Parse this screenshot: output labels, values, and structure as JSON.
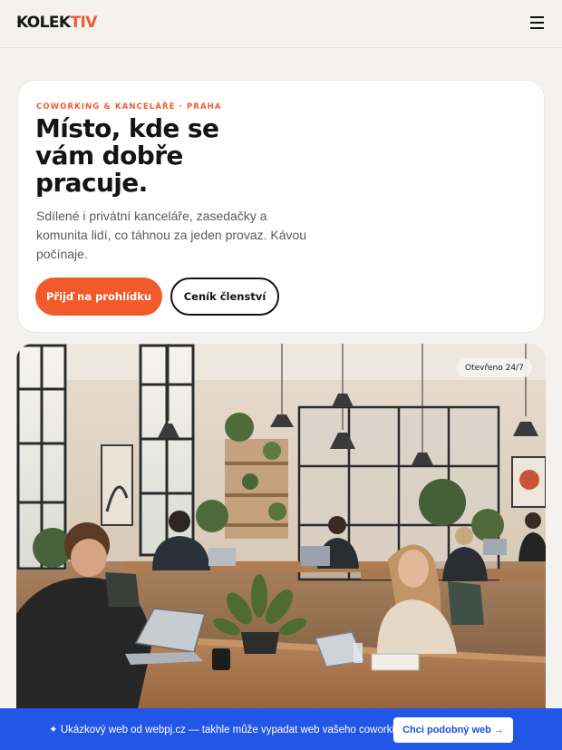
{
  "header": {
    "logo_main": "KOLEK",
    "logo_accent": "TIV",
    "menu_icon": "hamburger-menu-icon"
  },
  "hero": {
    "eyebrow": "COWORKING & KANCELÁŘE · PRAHA",
    "headline": "Místo, kde se vám dobře pracuje.",
    "lede": "Sdílené i privátní kanceláře, zasedačky a komunita lidí, co táhnou za jeden provaz. Kávou počínaje.",
    "primary_cta": "Přijď na prohlídku",
    "secondary_cta": "Ceník členství"
  },
  "photo": {
    "badge": "Otevřeno 24/7"
  },
  "promo": {
    "text": "✦ Ukázkový web od webpj.cz — takhle může vypadat web vašeho coworkingu.",
    "button": "Chci podobný web →"
  },
  "colors": {
    "accent": "#f25a2c",
    "promo_bg": "#2256e6",
    "page_bg": "#f3f2ef"
  }
}
